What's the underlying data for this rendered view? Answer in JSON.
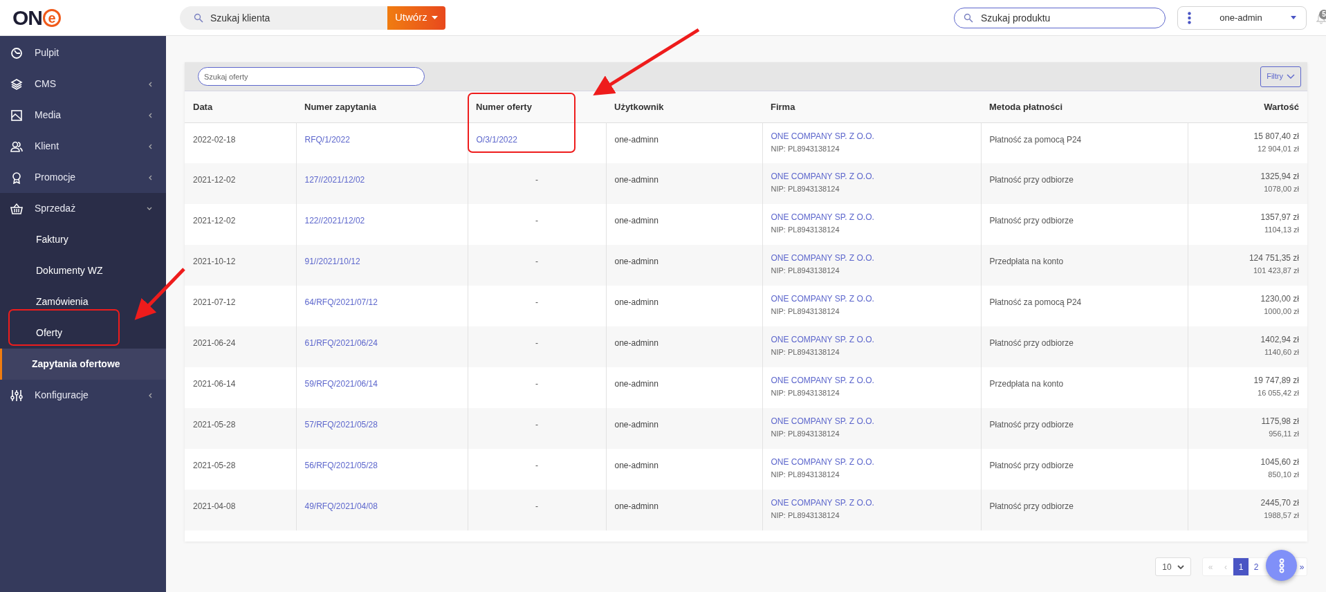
{
  "logo": {
    "text": "ON",
    "mark": "e"
  },
  "topbar": {
    "client_search": {
      "placeholder": "Szukaj klienta"
    },
    "create_button": "Utwórz",
    "product_search": {
      "placeholder": "Szukaj produktu"
    },
    "user": "one-admin",
    "notifications": "5"
  },
  "sidebar": {
    "items": [
      {
        "kind": "link",
        "label": "Pulpit"
      },
      {
        "kind": "group",
        "label": "CMS",
        "expanded": false
      },
      {
        "kind": "group",
        "label": "Media",
        "expanded": false
      },
      {
        "kind": "group",
        "label": "Klient",
        "expanded": false
      },
      {
        "kind": "group",
        "label": "Promocje",
        "expanded": false
      },
      {
        "kind": "group",
        "label": "Sprzedaż",
        "expanded": true,
        "children": [
          {
            "label": "Faktury",
            "selected": false
          },
          {
            "label": "Dokumenty WZ",
            "selected": false
          },
          {
            "label": "Zamówienia",
            "selected": false
          },
          {
            "label": "Oferty",
            "selected": false
          },
          {
            "label": "Zapytania ofertowe",
            "selected": true
          }
        ]
      },
      {
        "kind": "group",
        "label": "Konfiguracje",
        "expanded": false
      }
    ]
  },
  "table": {
    "search": {
      "placeholder": "Szukaj oferty"
    },
    "filter_button": "Filtry",
    "columns": [
      "Data",
      "Numer zapytania",
      "Numer oferty",
      "Użytkownik",
      "Firma",
      "Metoda płatności",
      "Wartość"
    ],
    "rows": [
      {
        "date": "2022-02-18",
        "request": "RFQ/1/2022",
        "offer": "O/3/1/2022",
        "user": "one-adminn",
        "company": "ONE COMPANY SP. Z O.O.",
        "nip": "NIP: PL8943138124",
        "payment": "Płatność za pomocą P24",
        "gross": "15 807,40 zł",
        "net": "12 904,01 zł"
      },
      {
        "date": "2021-12-02",
        "request": "127//2021/12/02",
        "offer": "-",
        "user": "one-adminn",
        "company": "ONE COMPANY SP. Z O.O.",
        "nip": "NIP: PL8943138124",
        "payment": "Płatność przy odbiorze",
        "gross": "1325,94 zł",
        "net": "1078,00 zł"
      },
      {
        "date": "2021-12-02",
        "request": "122//2021/12/02",
        "offer": "-",
        "user": "one-adminn",
        "company": "ONE COMPANY SP. Z O.O.",
        "nip": "NIP: PL8943138124",
        "payment": "Płatność przy odbiorze",
        "gross": "1357,97 zł",
        "net": "1104,13 zł"
      },
      {
        "date": "2021-10-12",
        "request": "91//2021/10/12",
        "offer": "-",
        "user": "one-adminn",
        "company": "ONE COMPANY SP. Z O.O.",
        "nip": "NIP: PL8943138124",
        "payment": "Przedpłata na konto",
        "gross": "124 751,35 zł",
        "net": "101 423,87 zł"
      },
      {
        "date": "2021-07-12",
        "request": "64/RFQ/2021/07/12",
        "offer": "-",
        "user": "one-adminn",
        "company": "ONE COMPANY SP. Z O.O.",
        "nip": "NIP: PL8943138124",
        "payment": "Płatność za pomocą P24",
        "gross": "1230,00 zł",
        "net": "1000,00 zł"
      },
      {
        "date": "2021-06-24",
        "request": "61/RFQ/2021/06/24",
        "offer": "-",
        "user": "one-adminn",
        "company": "ONE COMPANY SP. Z O.O.",
        "nip": "NIP: PL8943138124",
        "payment": "Płatność przy odbiorze",
        "gross": "1402,94 zł",
        "net": "1140,60 zł"
      },
      {
        "date": "2021-06-14",
        "request": "59/RFQ/2021/06/14",
        "offer": "-",
        "user": "one-adminn",
        "company": "ONE COMPANY SP. Z O.O.",
        "nip": "NIP: PL8943138124",
        "payment": "Przedpłata na konto",
        "gross": "19 747,89 zł",
        "net": "16 055,42 zł"
      },
      {
        "date": "2021-05-28",
        "request": "57/RFQ/2021/05/28",
        "offer": "-",
        "user": "one-adminn",
        "company": "ONE COMPANY SP. Z O.O.",
        "nip": "NIP: PL8943138124",
        "payment": "Płatność przy odbiorze",
        "gross": "1175,98 zł",
        "net": "956,11 zł"
      },
      {
        "date": "2021-05-28",
        "request": "56/RFQ/2021/05/28",
        "offer": "-",
        "user": "one-adminn",
        "company": "ONE COMPANY SP. Z O.O.",
        "nip": "NIP: PL8943138124",
        "payment": "Płatność przy odbiorze",
        "gross": "1045,60 zł",
        "net": "850,10 zł"
      },
      {
        "date": "2021-04-08",
        "request": "49/RFQ/2021/04/08",
        "offer": "-",
        "user": "one-adminn",
        "company": "ONE COMPANY SP. Z O.O.",
        "nip": "NIP: PL8943138124",
        "payment": "Płatność przy odbiorze",
        "gross": "2445,70 zł",
        "net": "1988,57 zł"
      }
    ]
  },
  "pagination": {
    "page_size": "10",
    "pages": [
      {
        "label": "«",
        "selected": false,
        "disabled": true
      },
      {
        "label": "‹",
        "selected": false,
        "disabled": true
      },
      {
        "label": "1",
        "selected": true,
        "disabled": false
      },
      {
        "label": "2",
        "selected": false,
        "disabled": false
      },
      {
        "label": "»",
        "selected": false,
        "disabled": false
      }
    ]
  }
}
